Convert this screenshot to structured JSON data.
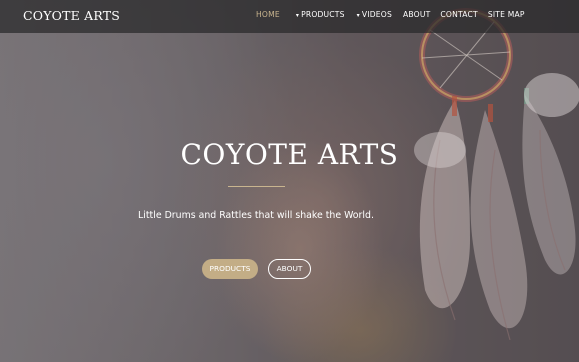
{
  "brand": "COYOTE ARTS",
  "nav": {
    "items": [
      {
        "label": "HOME",
        "active": true,
        "dropdown": false
      },
      {
        "label": "PRODUCTS",
        "active": false,
        "dropdown": true
      },
      {
        "label": "VIDEOS",
        "active": false,
        "dropdown": true
      },
      {
        "label": "ABOUT",
        "active": false,
        "dropdown": false
      },
      {
        "label": "CONTACT",
        "active": false,
        "dropdown": false
      },
      {
        "label": "SITE MAP",
        "active": false,
        "dropdown": false
      }
    ]
  },
  "hero": {
    "title": "COYOTE ARTS",
    "tagline": "Little Drums and Rattles that will shake the World.",
    "buttons": {
      "products": "PRODUCTS",
      "about": "ABOUT"
    }
  },
  "colors": {
    "accent": "#c3ad86",
    "navbar": "#28282a",
    "text": "#ffffff"
  }
}
